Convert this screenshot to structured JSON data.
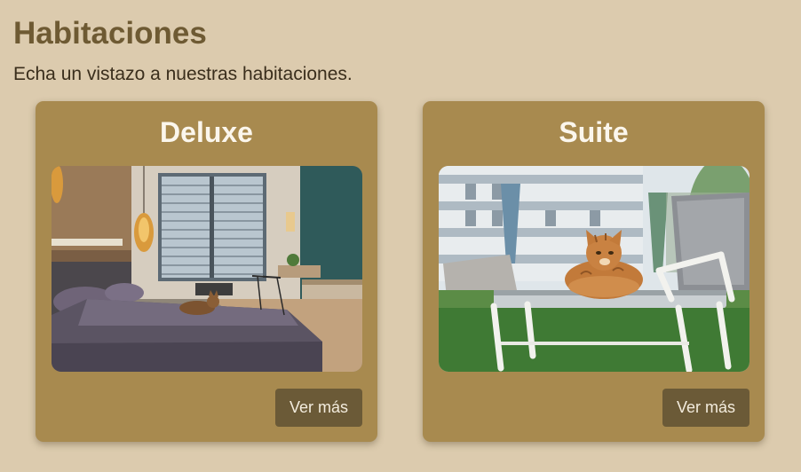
{
  "header": {
    "title": "Habitaciones",
    "subtitle": "Echa un vistazo a nuestras habitaciones."
  },
  "rooms": [
    {
      "title": "Deluxe",
      "photo": "bedroom-with-cat-photo",
      "button_label": "Ver más"
    },
    {
      "title": "Suite",
      "photo": "cat-on-sun-lounger-photo",
      "button_label": "Ver más"
    }
  ],
  "colors": {
    "background": "#dccbae",
    "heading": "#6e5a33",
    "card": "#a88a4f",
    "button": "#6b5a37",
    "button_text": "#f3ecdd"
  }
}
